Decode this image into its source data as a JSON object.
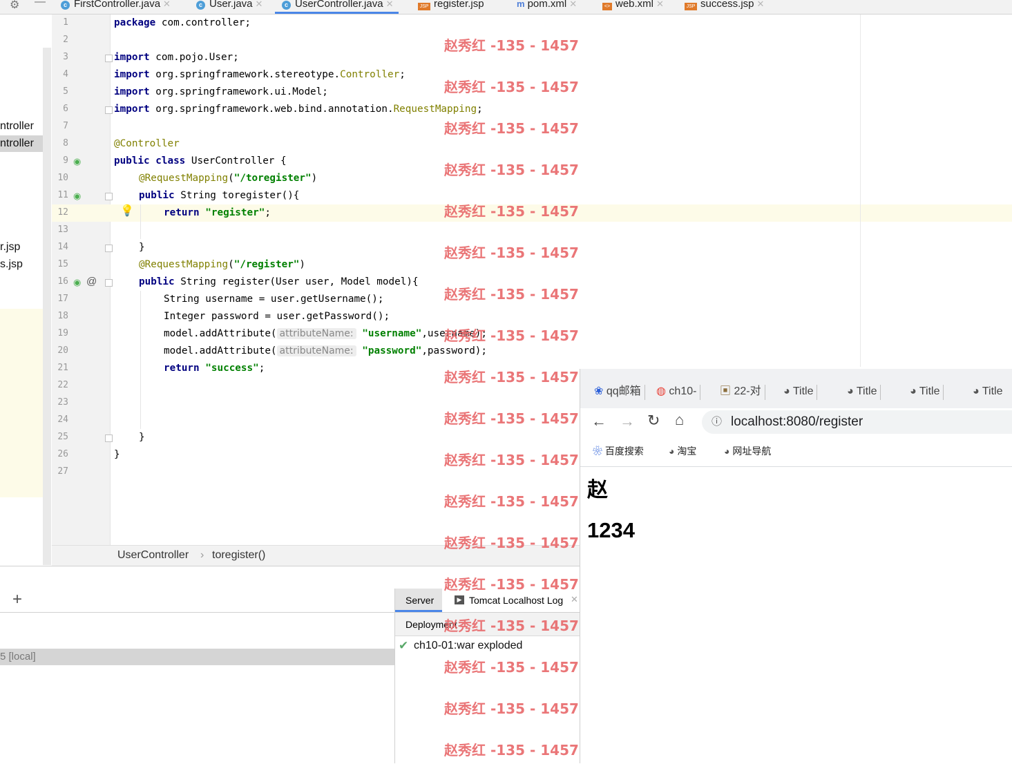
{
  "tabs": [
    {
      "label": "FirstController.java",
      "icon": "class-icon"
    },
    {
      "label": "User.java",
      "icon": "class-icon"
    },
    {
      "label": "UserController.java",
      "icon": "class-icon",
      "active": true
    },
    {
      "label": "register.jsp",
      "icon": "jsp-file-icon"
    },
    {
      "label": "pom.xml",
      "icon": "maven-icon"
    },
    {
      "label": "web.xml",
      "icon": "xml-file-icon"
    },
    {
      "label": "success.jsp",
      "icon": "jsp-file-icon"
    }
  ],
  "project_tree": {
    "items": [
      "ntroller",
      "ntroller",
      "r.jsp",
      "s.jsp"
    ]
  },
  "editor": {
    "line_numbers": [
      "1",
      "2",
      "3",
      "4",
      "5",
      "6",
      "7",
      "8",
      "9",
      "10",
      "11",
      "12",
      "13",
      "14",
      "15",
      "16",
      "17",
      "18",
      "19",
      "20",
      "21",
      "22",
      "23",
      "24",
      "25",
      "26",
      "27"
    ],
    "lines": {
      "l1_kw": "package",
      "l1_rest": " com.controller;",
      "l3_kw": "import",
      "l3_rest": " com.pojo.User;",
      "l4_kw": "import",
      "l4_rest": " org.springframework.stereotype.",
      "l4_ann": "Controller",
      "l4_end": ";",
      "l5_kw": "import",
      "l5_rest": " org.springframework.ui.Model;",
      "l6_kw": "import",
      "l6_rest": " org.springframework.web.bind.annotation.",
      "l6_ann": "RequestMapping",
      "l6_end": ";",
      "l8_ann": "@Controller",
      "l9_kw": "public class",
      "l9_rest": " UserController {",
      "l10_ann": "@RequestMapping",
      "l10_open": "(",
      "l10_str": "\"/toregister\"",
      "l10_close": ")",
      "l11_kw": "public",
      "l11_rest": " String toregister(){",
      "l12_kw": "return",
      "l12_str": " \"register\"",
      "l12_end": ";",
      "l14": "}",
      "l15_ann": "@RequestMapping",
      "l15_open": "(",
      "l15_str": "\"/register\"",
      "l15_close": ")",
      "l16_kw": "public",
      "l16_rest": " String register(User user, Model model){",
      "l17": "String username = user.getUsername();",
      "l18": "Integer password = user.getPassword();",
      "l19_a": "model.addAttribute(",
      "l19_hint": "attributeName:",
      "l19_str": "\"username\"",
      "l19_end": ",username);",
      "l20_a": "model.addAttribute(",
      "l20_hint": "attributeName:",
      "l20_str": "\"password\"",
      "l20_end": ",password);",
      "l21_kw": "return",
      "l21_str": " \"success\"",
      "l21_end": ";",
      "l25": "}",
      "l26": "}"
    }
  },
  "breadcrumb": {
    "class": "UserController",
    "sep": "›",
    "method": "toregister()"
  },
  "services": {
    "add_label": "+",
    "selected_row": "5 [local]",
    "tabs": [
      "Server",
      "Tomcat Localhost Log"
    ],
    "deployment_label": "Deployment",
    "artifact": "ch10-01:war exploded"
  },
  "browser": {
    "tabs": [
      "qq邮箱",
      "ch10-",
      "22-对",
      "Title",
      "Title",
      "Title",
      "Title"
    ],
    "url": "localhost:8080/register",
    "bookmarks": [
      "百度搜索",
      "淘宝",
      "网址导航"
    ],
    "page": {
      "heading1": "赵",
      "heading2": "1234"
    }
  },
  "watermark": "赵秀红 -135 - 1457",
  "colors": {
    "keyword": "#000080",
    "string": "#008000",
    "annotation": "#808000",
    "watermark": "#e8686a",
    "accent": "#4a86e8"
  }
}
